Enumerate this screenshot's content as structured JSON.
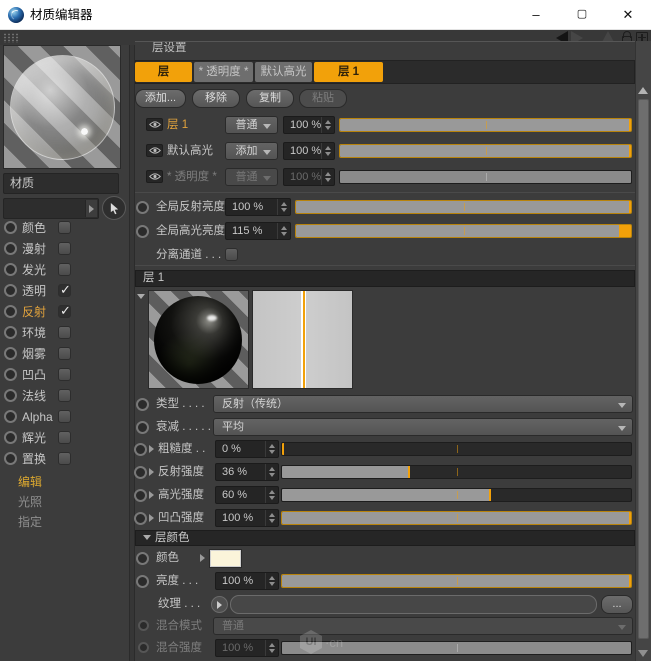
{
  "window": {
    "title": "材质编辑器",
    "minimize": "–",
    "maximize": "▢",
    "close": "✕"
  },
  "accent": "#F2A10A",
  "sidebar": {
    "material_name": "材质",
    "channels": [
      {
        "label": "颜色",
        "checked": false,
        "active": false
      },
      {
        "label": "漫射",
        "checked": false,
        "active": false
      },
      {
        "label": "发光",
        "checked": false,
        "active": false
      },
      {
        "label": "透明",
        "checked": true,
        "active": false
      },
      {
        "label": "反射",
        "checked": true,
        "active": true
      },
      {
        "label": "环境",
        "checked": false,
        "active": false
      },
      {
        "label": "烟雾",
        "checked": false,
        "active": false
      },
      {
        "label": "凹凸",
        "checked": false,
        "active": false
      },
      {
        "label": "法线",
        "checked": false,
        "active": false
      },
      {
        "label": "Alpha",
        "checked": false,
        "active": false
      },
      {
        "label": "辉光",
        "checked": false,
        "active": false
      },
      {
        "label": "置换",
        "checked": false,
        "active": false
      }
    ],
    "pages": [
      {
        "label": "编辑",
        "active": true
      },
      {
        "label": "光照",
        "active": false
      },
      {
        "label": "指定",
        "active": false
      }
    ]
  },
  "main": {
    "group_title": "层设置",
    "tabs": [
      {
        "label": "层",
        "active": true
      },
      {
        "label": "* 透明度 *",
        "active": false
      },
      {
        "label": "默认高光",
        "active": false
      },
      {
        "label": "层 1",
        "active": true
      }
    ],
    "actions": [
      {
        "label": "添加...",
        "disabled": false
      },
      {
        "label": "移除",
        "disabled": false
      },
      {
        "label": "复制",
        "disabled": false
      },
      {
        "label": "粘贴",
        "disabled": true
      }
    ],
    "layers": [
      {
        "name": "层 1",
        "highlight": true,
        "blend": "普通",
        "value": "100 %",
        "percent": 100,
        "disabled": false
      },
      {
        "name": "默认高光",
        "highlight": false,
        "blend": "添加",
        "value": "100 %",
        "percent": 100,
        "disabled": false
      },
      {
        "name": "* 透明度 *",
        "highlight": false,
        "blend": "普通",
        "value": "100 %",
        "percent": 100,
        "disabled": true
      }
    ],
    "globals": [
      {
        "label": "全局反射亮度",
        "value": "100 %",
        "percent": 100
      },
      {
        "label": "全局高光亮度",
        "value": "115 %",
        "percent": 115
      }
    ],
    "separate_channels": {
      "label": "分离通道 . . . .",
      "checked": false
    },
    "layer_section": {
      "title": "层 1",
      "type": {
        "label": "类型  . . . .",
        "value": "反射（传统）"
      },
      "falloff": {
        "label": "衰减  . . . . .",
        "value": "平均"
      },
      "sliders": [
        {
          "label": "粗糙度 . .",
          "value": "0 %",
          "percent": 0
        },
        {
          "label": "反射强度",
          "value": "36 %",
          "percent": 36
        },
        {
          "label": "高光强度",
          "value": "60 %",
          "percent": 60
        },
        {
          "label": "凹凸强度",
          "value": "100 %",
          "percent": 100
        }
      ],
      "layer_color": {
        "title": "层颜色",
        "color": {
          "label": "颜色",
          "swatch": "#FBF4DA"
        },
        "brightness": {
          "label": "亮度  . . .",
          "value": "100 %",
          "percent": 100
        },
        "texture": {
          "label": "纹理  . . .",
          "browse": "..."
        },
        "blend_mode": {
          "label": "混合模式",
          "value": "普通"
        },
        "blend_strength": {
          "label": "混合强度",
          "value": "100 %",
          "percent": 100
        }
      }
    }
  },
  "watermark": {
    "logo": "UI",
    "suffix": "·cn"
  }
}
